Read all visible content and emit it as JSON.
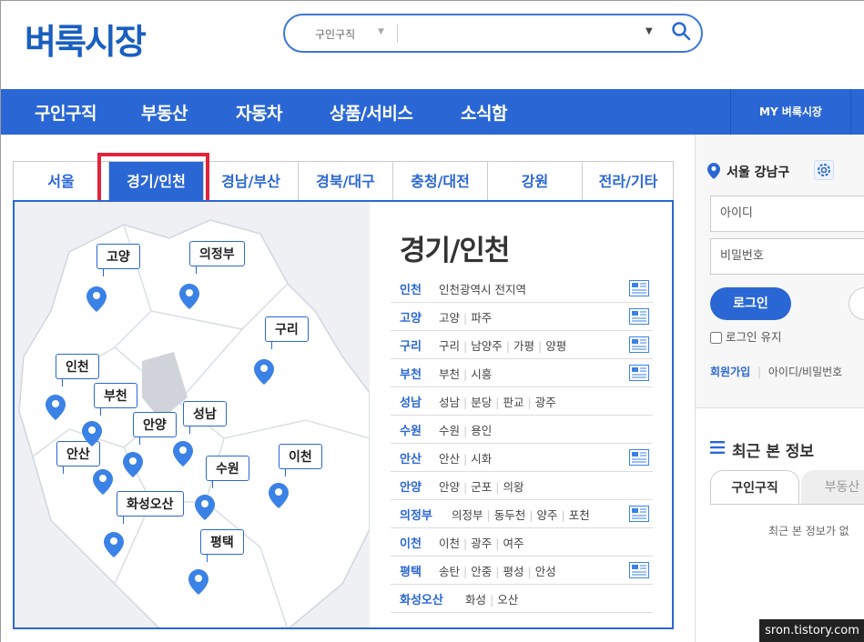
{
  "header": {
    "logo": "벼룩시장",
    "search": {
      "category": "구인구직",
      "value": ""
    }
  },
  "nav": {
    "items": [
      "구인구직",
      "부동산",
      "자동차",
      "상품/서비스",
      "소식함"
    ],
    "my": "MY 벼룩시장"
  },
  "region_tabs": [
    "서울",
    "경기/인천",
    "경남/부산",
    "경북/대구",
    "충청/대전",
    "강원",
    "전라/기타"
  ],
  "active_tab": "경기/인천",
  "map_labels": [
    "고양",
    "의정부",
    "구리",
    "인천",
    "부천",
    "안양",
    "성남",
    "안산",
    "수원",
    "이천",
    "화성오산",
    "평택"
  ],
  "region": {
    "title": "경기/인천",
    "rows": [
      {
        "key": "인천",
        "values": [
          "인천광역시 전지역"
        ],
        "news": true
      },
      {
        "key": "고양",
        "values": [
          "고양",
          "파주"
        ],
        "news": true
      },
      {
        "key": "구리",
        "values": [
          "구리",
          "남양주",
          "가평",
          "양평"
        ],
        "news": true
      },
      {
        "key": "부천",
        "values": [
          "부천",
          "시흥"
        ],
        "news": true
      },
      {
        "key": "성남",
        "values": [
          "성남",
          "분당",
          "판교",
          "광주"
        ],
        "news": false
      },
      {
        "key": "수원",
        "values": [
          "수원",
          "용인"
        ],
        "news": false
      },
      {
        "key": "안산",
        "values": [
          "안산",
          "시화"
        ],
        "news": true
      },
      {
        "key": "안양",
        "values": [
          "안양",
          "군포",
          "의왕"
        ],
        "news": false
      },
      {
        "key": "의정부",
        "values": [
          "의정부",
          "동두천",
          "양주",
          "포천"
        ],
        "news": true
      },
      {
        "key": "이천",
        "values": [
          "이천",
          "광주",
          "여주"
        ],
        "news": false
      },
      {
        "key": "평택",
        "values": [
          "송탄",
          "안중",
          "평성",
          "안성"
        ],
        "news": true
      },
      {
        "key": "화성오산",
        "values": [
          "화성",
          "오산"
        ],
        "news": false
      }
    ]
  },
  "sidebar": {
    "location": "서울 강남구",
    "id_placeholder": "아이디",
    "pw_placeholder": "비밀번호",
    "login": "로그인",
    "keep_login": "로그인 유지",
    "join": "회원가입",
    "find": "아이디/비밀번호",
    "recent_title": "최근 본 정보",
    "recent_tabs": [
      "구인구직",
      "부동산"
    ],
    "recent_empty": "최근 본 정보가 없"
  },
  "watermark": "sron.tistory.com",
  "colors": {
    "brand": "#2a67d4",
    "highlight": "#e0243a"
  }
}
